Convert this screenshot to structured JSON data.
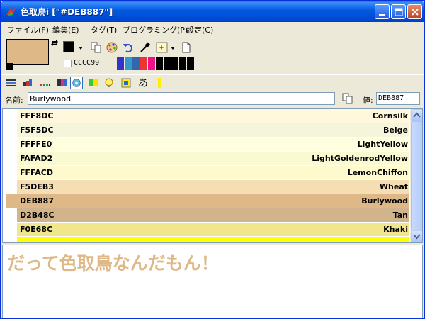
{
  "window": {
    "title": "色取鳥i [\"#DEB887\"]",
    "title_bar_color": "#0055e5"
  },
  "menu": [
    {
      "label": "ファイル(F)"
    },
    {
      "label": "編集(E)"
    },
    {
      "label": "タグ(T)"
    },
    {
      "label": "プログラミング(P)"
    },
    {
      "label": "設定(C)"
    }
  ],
  "current_color": "#DEB887",
  "secondary_color": "#000000",
  "checkbox_hex": "CCCC99",
  "palette_colors": [
    "#3333cc",
    "#3399cc",
    "#3366aa",
    "#ee3333",
    "#ee1188",
    "#000000",
    "#000000",
    "#000000",
    "#000000",
    "#000000"
  ],
  "icons": {
    "tools": [
      "copy-icon",
      "palette-icon",
      "undo-icon",
      "eyedropper-icon",
      "sparkle-box-icon",
      "new-page-icon"
    ],
    "row": [
      "list-icon",
      "gradient-bar-icon",
      "color-dots-icon",
      "multicolor-icon",
      "gear-color-icon",
      "green-blue-icon",
      "bulb-icon",
      "yellow-box-icon",
      "hiragana-icon",
      "yellow-bar-icon"
    ]
  },
  "name_field": {
    "label": "名前:",
    "value": "Burlywood"
  },
  "value_field": {
    "label": "値:",
    "value": "DEB887"
  },
  "colors": [
    {
      "hex": "FFF8DC",
      "name": "Cornsilk",
      "bg": "#FFF8DC"
    },
    {
      "hex": "F5F5DC",
      "name": "Beige",
      "bg": "#F5F5DC"
    },
    {
      "hex": "FFFFE0",
      "name": "LightYellow",
      "bg": "#FFFFE0"
    },
    {
      "hex": "FAFAD2",
      "name": "LightGoldenrodYellow",
      "bg": "#FAFAD2"
    },
    {
      "hex": "FFFACD",
      "name": "LemonChiffon",
      "bg": "#FFFACD"
    },
    {
      "hex": "F5DEB3",
      "name": "Wheat",
      "bg": "#F5DEB3"
    },
    {
      "hex": "DEB887",
      "name": "Burlywood",
      "bg": "#DEB887",
      "selected": true
    },
    {
      "hex": "D2B48C",
      "name": "Tan",
      "bg": "#D2B48C"
    },
    {
      "hex": "F0E68C",
      "name": "Khaki",
      "bg": "#F0E68C"
    },
    {
      "hex": "",
      "name": "",
      "bg": "#FFFF00"
    }
  ],
  "preview_text": "だって色取鳥なんだもん！"
}
